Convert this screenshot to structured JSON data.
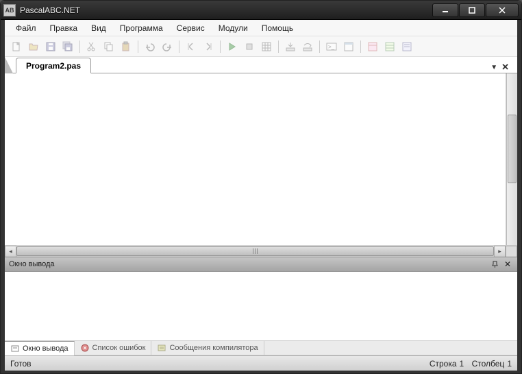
{
  "window": {
    "title": "PascalABC.NET"
  },
  "menu": {
    "items": [
      "Файл",
      "Правка",
      "Вид",
      "Программа",
      "Сервис",
      "Модули",
      "Помощь"
    ]
  },
  "tabs": {
    "active": "Program2.pas"
  },
  "output": {
    "header": "Окно вывода",
    "tabs": [
      "Окно вывода",
      "Список ошибок",
      "Сообщения компилятора"
    ]
  },
  "status": {
    "ready": "Готов",
    "line_label": "Строка",
    "line": "1",
    "col_label": "Столбец",
    "col": "1"
  }
}
